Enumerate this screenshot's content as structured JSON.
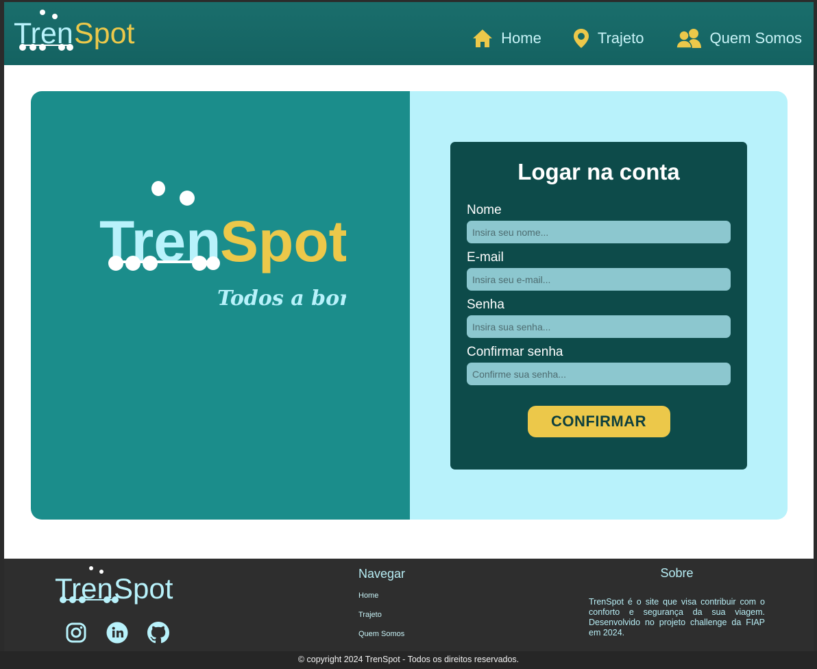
{
  "brand": {
    "name_part1": "Tren",
    "name_part2": "Spot",
    "tagline": "Todos a bordo!"
  },
  "header": {
    "nav": [
      {
        "label": "Home",
        "icon": "home-icon"
      },
      {
        "label": "Trajeto",
        "icon": "location-pin-icon"
      },
      {
        "label": "Quem Somos",
        "icon": "users-icon"
      }
    ]
  },
  "form": {
    "title": "Logar na conta",
    "fields": [
      {
        "label": "Nome",
        "placeholder": "Insira seu nome..."
      },
      {
        "label": "E-mail",
        "placeholder": "Insira seu e-mail..."
      },
      {
        "label": "Senha",
        "placeholder": "Insira sua senha..."
      },
      {
        "label": "Confirmar senha",
        "placeholder": "Confirme sua senha..."
      }
    ],
    "submit_label": "CONFIRMAR"
  },
  "footer": {
    "socials": [
      "instagram-icon",
      "linkedin-icon",
      "github-icon"
    ],
    "nav_title": "Navegar",
    "nav_links": [
      "Home",
      "Trajeto",
      "Quem Somos"
    ],
    "about_title": "Sobre",
    "about_text": "TrenSpot é o site que visa contribuir com o conforto e segurança da sua viagem. Desenvolvido no projeto challenge da FIAP em 2024.",
    "copyright": "© copyright 2024 TrenSpot - Todos os direitos reservados."
  },
  "colors": {
    "header": "#1a6e6c",
    "accent_yellow": "#ecc84a",
    "light_cyan": "#b8f2fb",
    "teal_panel": "#1b8d8b",
    "form_bg": "#0d4b4a",
    "footer_bg": "#2e2e2e"
  }
}
